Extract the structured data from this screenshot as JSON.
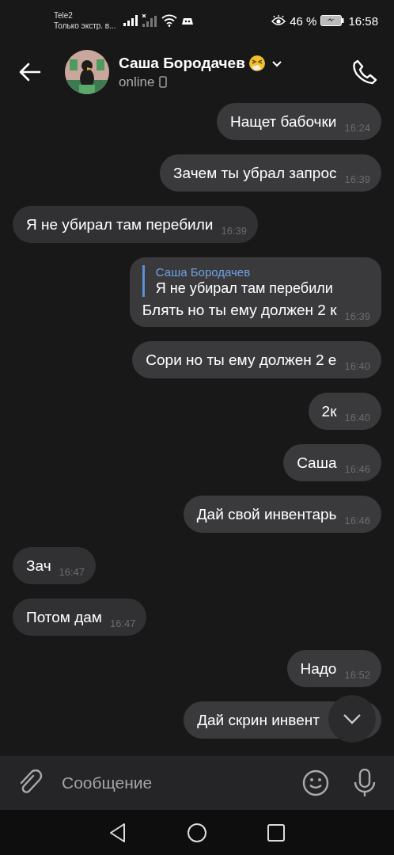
{
  "status_bar": {
    "carrier": "Tele2",
    "network_note": "Только экстр. в...",
    "battery_percent": "46 %",
    "time": "16:58"
  },
  "header": {
    "name": "Саша Бородачев",
    "presence": "online"
  },
  "messages": [
    {
      "outgoing": true,
      "text": "Нащет бабочки",
      "time": "16:24"
    },
    {
      "outgoing": true,
      "text": "Зачем ты убрал запрос",
      "time": "16:39"
    },
    {
      "outgoing": false,
      "text": "Я не убирал там перебили",
      "time": "16:39"
    },
    {
      "outgoing": true,
      "reply": {
        "author": "Саша Бородачев",
        "text": "Я не убирал там перебили"
      },
      "text": "Блять но ты ему должен 2 к",
      "time": "16:39"
    },
    {
      "outgoing": true,
      "text": "Сори но ты ему должен 2 е",
      "time": "16:40"
    },
    {
      "outgoing": true,
      "text": "2к",
      "time": "16:40"
    },
    {
      "outgoing": true,
      "text": "Саша",
      "time": "16:46"
    },
    {
      "outgoing": true,
      "text": "Дай свой инвентарь",
      "time": "16:46"
    },
    {
      "outgoing": false,
      "text": "Зач",
      "time": "16:47"
    },
    {
      "outgoing": false,
      "text": "Потом дам",
      "time": "16:47"
    },
    {
      "outgoing": true,
      "text": "Надо",
      "time": "16:52"
    },
    {
      "outgoing": true,
      "text": "Дай скрин инвент"
    }
  ],
  "composer": {
    "placeholder": "Сообщение"
  }
}
